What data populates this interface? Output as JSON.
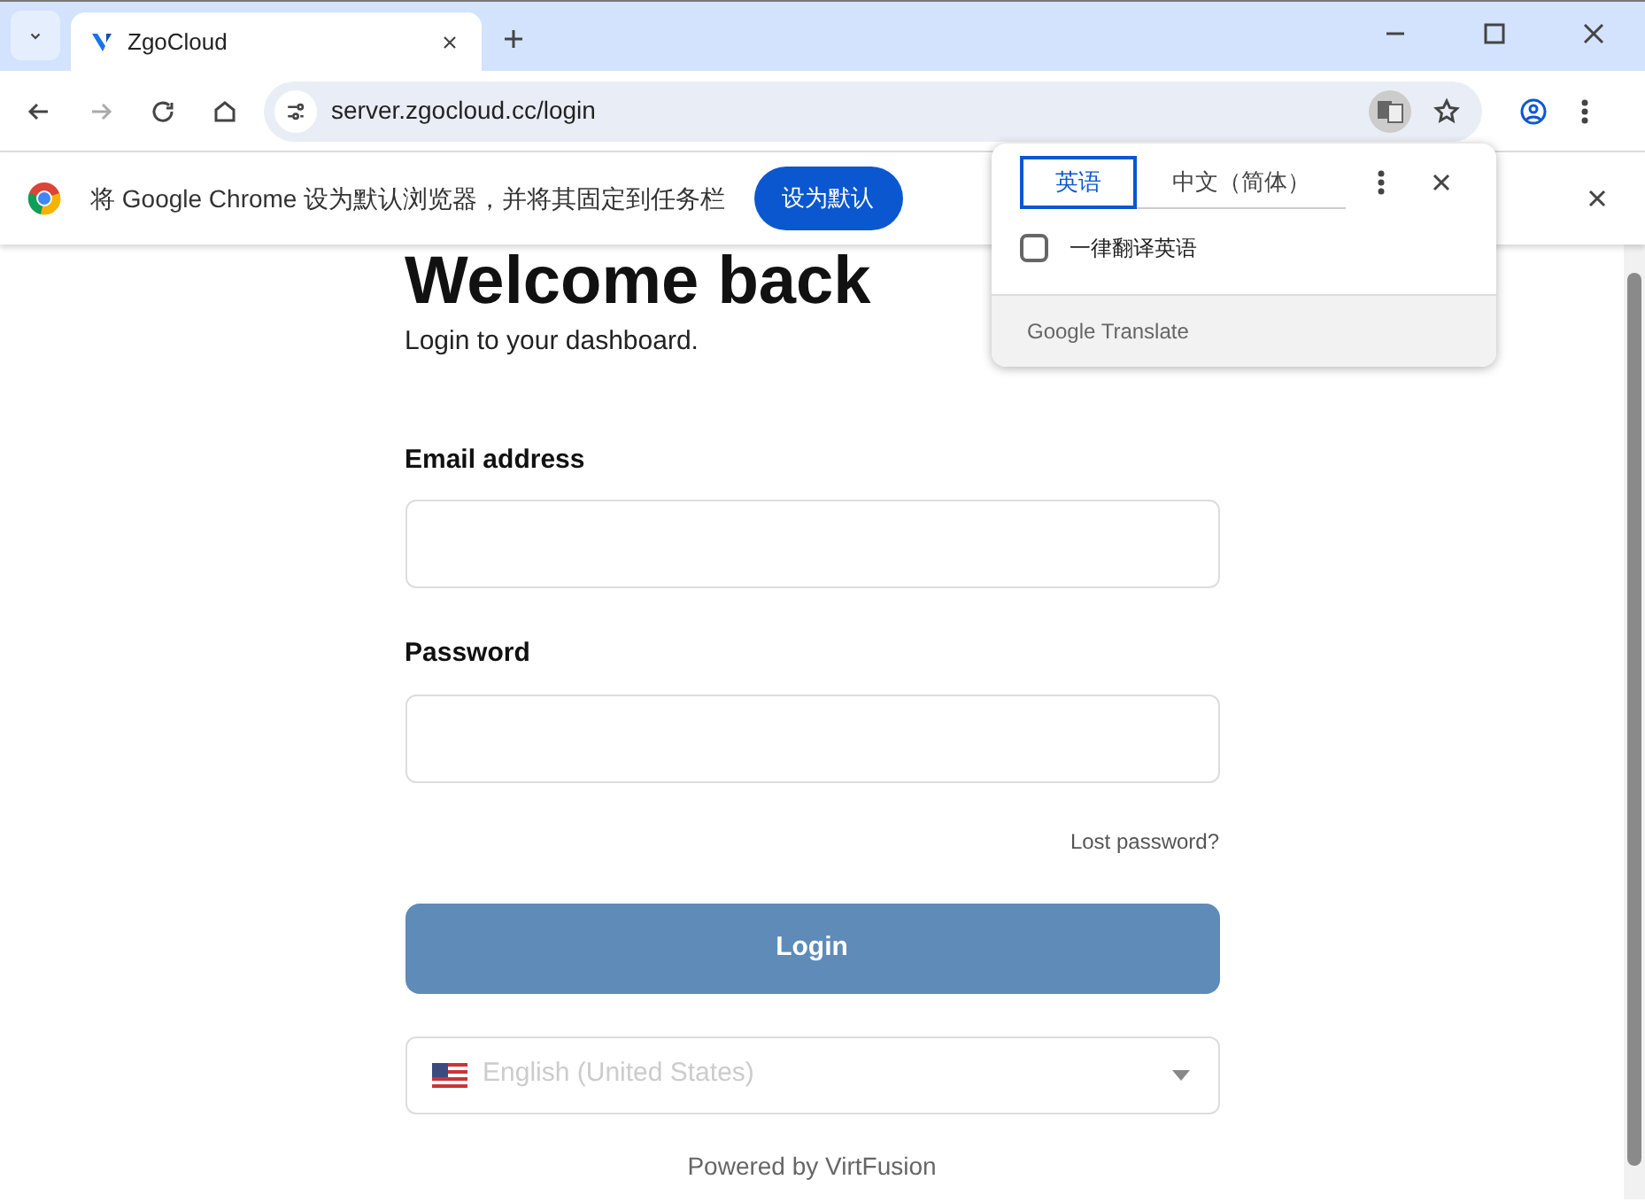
{
  "browser": {
    "tabs": [
      {
        "title": "ZgoCloud",
        "selected": true
      }
    ],
    "address": "server.zgocloud.cc/login"
  },
  "infobar": {
    "message": "将 Google Chrome 设为默认浏览器，并将其固定到任务栏",
    "button": "设为默认"
  },
  "translate_popup": {
    "languages": [
      {
        "label": "英语",
        "selected": true
      },
      {
        "label": "中文（简体）",
        "selected": false
      }
    ],
    "option": {
      "label": "一律翻译英语",
      "checked": false
    },
    "footer": "Google Translate"
  },
  "page": {
    "title": "Welcome back",
    "subtitle": "Login to your dashboard.",
    "fields": [
      {
        "label": "Email address"
      },
      {
        "label": "Password"
      }
    ],
    "lost_password": "Lost password?",
    "login_button": "Login",
    "language_select": "English (United States)",
    "powered_by": "Powered by VirtFusion"
  }
}
